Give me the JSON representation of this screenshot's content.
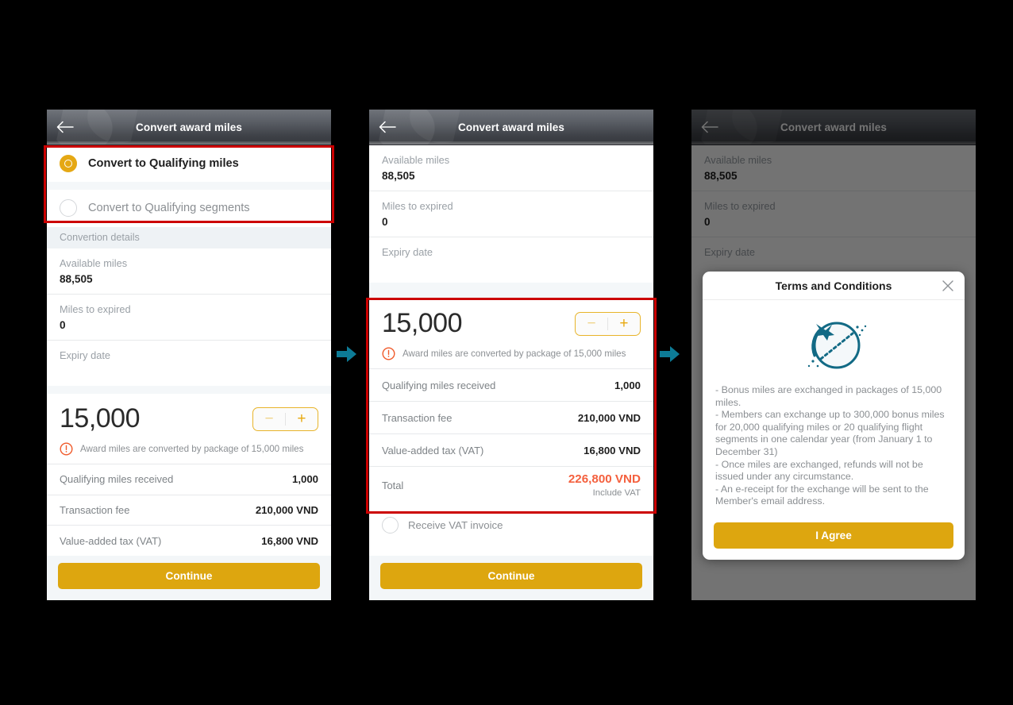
{
  "app": {
    "title": "Convert award miles",
    "back_icon": "arrow-left-icon"
  },
  "panel1": {
    "options": [
      {
        "label": "Convert to Qualifying miles",
        "selected": true
      },
      {
        "label": "Convert to Qualifying segments",
        "selected": false
      }
    ],
    "section_header": "Convertion details",
    "fields": [
      {
        "label": "Available miles",
        "value": "88,505"
      },
      {
        "label": "Miles to expired",
        "value": "0"
      },
      {
        "label": "Expiry date",
        "value": ""
      }
    ],
    "amount": "15,000",
    "stepper": {
      "minus": "−",
      "plus": "+"
    },
    "warning": "Award miles are converted by package of 15,000 miles",
    "rows": [
      {
        "label": "Qualifying miles received",
        "value": "1,000"
      },
      {
        "label": "Transaction fee",
        "value": "210,000 VND"
      },
      {
        "label": "Value-added tax (VAT)",
        "value": "16,800 VND"
      }
    ],
    "cta": "Continue"
  },
  "panel2": {
    "fields": [
      {
        "label": "Available miles",
        "value": "88,505"
      },
      {
        "label": "Miles to expired",
        "value": "0"
      },
      {
        "label": "Expiry date",
        "value": ""
      }
    ],
    "amount": "15,000",
    "stepper": {
      "minus": "−",
      "plus": "+"
    },
    "warning": "Award miles are converted by package of 15,000 miles",
    "rows": [
      {
        "label": "Qualifying miles received",
        "value": "1,000"
      },
      {
        "label": "Transaction fee",
        "value": "210,000 VND"
      },
      {
        "label": "Value-added tax (VAT)",
        "value": "16,800 VND"
      }
    ],
    "total": {
      "label": "Total",
      "value": "226,800 VND",
      "note": "Include VAT"
    },
    "vat_invoice": "Receive VAT invoice",
    "cta": "Continue"
  },
  "panel3": {
    "fields": [
      {
        "label": "Available miles",
        "value": "88,505"
      },
      {
        "label": "Miles to expired",
        "value": "0"
      },
      {
        "label": "Expiry date",
        "value": ""
      }
    ],
    "dialog": {
      "title": "Terms and Conditions",
      "close_icon": "close-icon",
      "illustration": "globe-with-plane-icon",
      "terms": "- Bonus miles are exchanged in packages of 15,000 miles.\n- Members can exchange up to 300,000 bonus miles for 20,000 qualifying miles or 20 qualifying flight segments in one calendar year (from January 1 to December 31)\n- Once miles are exchanged, refunds will not be issued under any circumstance.\n- An e-receipt for the exchange will be sent to the Member's email address.",
      "cta": "I Agree"
    }
  },
  "annotations": {
    "arrow1": "flow-arrow-right",
    "arrow2": "flow-arrow-right",
    "highlight1": "highlight-box-convert-options",
    "highlight2": "highlight-box-amount-summary"
  },
  "colors": {
    "brand_gold": "#dda60f",
    "stepper_border": "#e8b42a",
    "total_orange": "#f4603e",
    "highlight_red": "#cc0000",
    "arrow_teal": "#0b6e87",
    "header_dark": "#585c63"
  }
}
